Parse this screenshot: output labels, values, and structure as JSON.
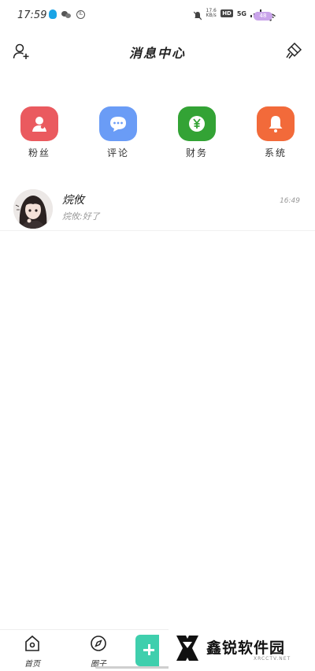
{
  "status_bar": {
    "time": "17:59",
    "net_speed": "17.6 KB/s",
    "hd": "HD",
    "network": "5G",
    "battery": "48"
  },
  "header": {
    "title": "消息中心"
  },
  "categories": [
    {
      "label": "粉丝",
      "icon": "person-icon",
      "color": "#ea5a5f"
    },
    {
      "label": "评论",
      "icon": "comment-icon",
      "color": "#6a9cf6"
    },
    {
      "label": "财务",
      "icon": "yuan-icon",
      "color": "#33a335"
    },
    {
      "label": "系统",
      "icon": "bell-icon",
      "color": "#f26a3a"
    }
  ],
  "messages": [
    {
      "name": "烷攸",
      "preview": "烷攸:好了",
      "time": "16:49"
    }
  ],
  "bottom_nav": {
    "home_label": "首页",
    "circle_label": "圈子"
  },
  "watermark": {
    "brand": "鑫锐软件园",
    "site": "XRCCTV.NET"
  },
  "colors": {
    "accent_green": "#3fcfad"
  }
}
